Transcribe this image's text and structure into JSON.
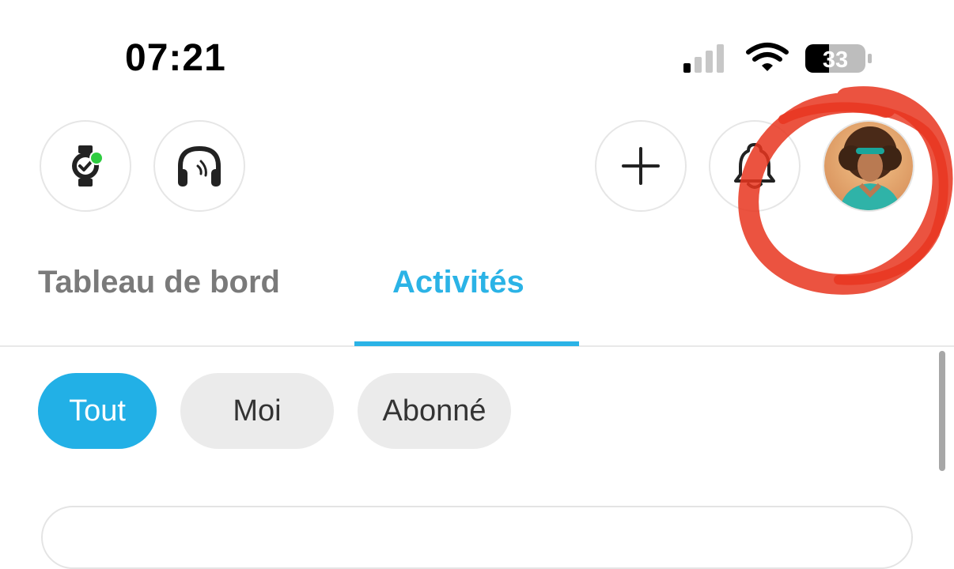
{
  "status_bar": {
    "time": "07:21",
    "battery_level": "33",
    "signal_bars_active": 1,
    "signal_bars_total": 4,
    "icons": [
      "signal-icon",
      "wifi-icon",
      "battery-icon"
    ]
  },
  "header": {
    "buttons": [
      {
        "name": "watch-icon",
        "has_status_dot": true,
        "status_color": "#2ecc40"
      },
      {
        "name": "headphones-icon"
      },
      {
        "name": "plus-icon"
      },
      {
        "name": "bell-icon"
      },
      {
        "name": "avatar"
      }
    ],
    "annotation_color": "#e8351e"
  },
  "tabs": {
    "items": [
      {
        "label": "Tableau de bord",
        "active": false
      },
      {
        "label": "Activités",
        "active": true
      }
    ],
    "active_color": "#2bb3e6"
  },
  "filters": {
    "chips": [
      {
        "label": "Tout",
        "selected": true
      },
      {
        "label": "Moi",
        "selected": false
      },
      {
        "label": "Abonné",
        "selected": false
      }
    ]
  }
}
